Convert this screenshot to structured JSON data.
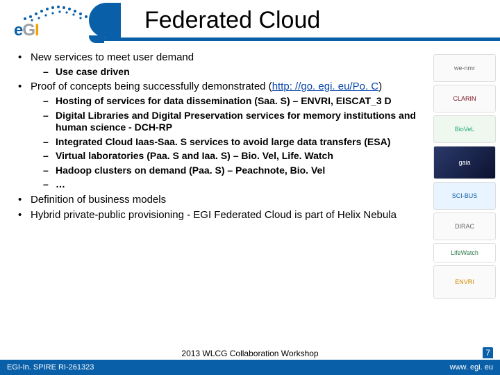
{
  "header": {
    "logo_text_parts": {
      "e": "e",
      "g": "G",
      "i": "I"
    },
    "title": "Federated Cloud"
  },
  "bullets": {
    "b1": "New services to meet user demand",
    "b1_s1": "Use case driven",
    "b2_pre": "Proof of concepts being successfully demonstrated (",
    "b2_link": "http: //go. egi. eu/Po. C",
    "b2_post": ")",
    "b2_s1": "Hosting of services for data dissemination (Saa. S) – ENVRI, EISCAT_3 D",
    "b2_s2": "Digital Libraries and Digital Preservation services for memory institutions and human science - DCH-RP",
    "b2_s3": "Integrated Cloud Iaas-Saa. S services to avoid large data transfers (ESA)",
    "b2_s4": "Virtual laboratories (Paa. S and Iaa. S) – Bio. Vel, Life. Watch",
    "b2_s5": "Hadoop clusters on demand (Paa. S) – Peachnote, Bio. Vel",
    "b2_s6": "…",
    "b3": "Definition of business models",
    "b4": "Hybrid private-public provisioning - EGI Federated Cloud is part of Helix Nebula"
  },
  "sidebar_logos": [
    "we-nmr",
    "CLARIN",
    "BioVeL",
    "gaia",
    "SCI-BUS",
    "DIRAC",
    "LifeWatch",
    "ENVRI"
  ],
  "footer": {
    "left": "EGI-In. SPIRE RI-261323",
    "center": "2013 WLCG Collaboration Workshop",
    "right": "www. egi. eu",
    "page": "7"
  }
}
